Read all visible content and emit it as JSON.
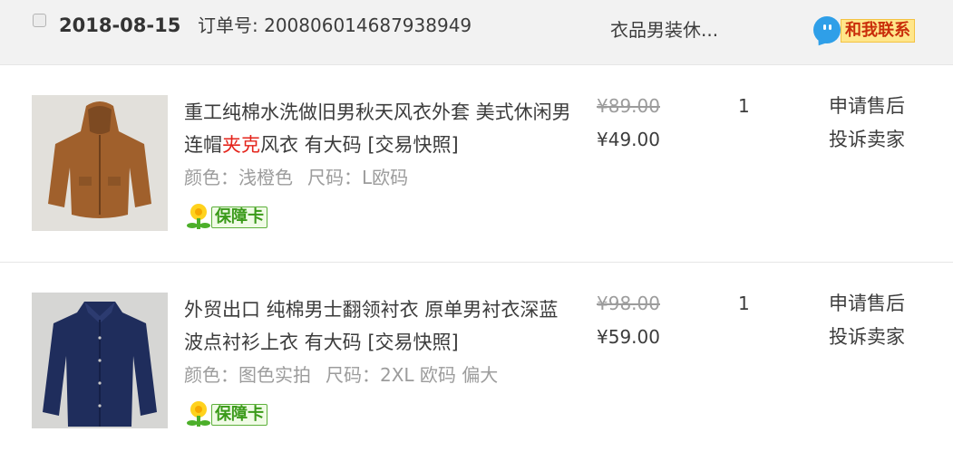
{
  "order": {
    "date": "2018-08-15",
    "order_number": "订单号: 200806014687938949",
    "shop_name": "衣品男装休...",
    "contact_label": "和我联系"
  },
  "items": [
    {
      "title_prefix": "重工纯棉水洗做旧男秋天风衣外套 美式休闲男连帽",
      "title_highlight": "夹克",
      "title_suffix": "风衣 有大码 [交易快照]",
      "color_label": "颜色：",
      "color_value": "浅橙色",
      "size_label": "尺码：",
      "size_value": "L欧码",
      "badge_label": "保障卡",
      "original_price": "¥89.00",
      "price": "¥49.00",
      "quantity": "1",
      "action_aftersale": "申请售后",
      "action_complain": "投诉卖家",
      "product_color": "#a0602c"
    },
    {
      "title_prefix": "外贸出口 纯棉男士翻领衬衣 原单男衬衣深蓝波点衬衫上衣 有大码 [交易快照]",
      "title_highlight": "",
      "title_suffix": "",
      "color_label": "颜色：",
      "color_value": "图色实拍",
      "size_label": "尺码：",
      "size_value": "2XL 欧码 偏大",
      "badge_label": "保障卡",
      "original_price": "¥98.00",
      "price": "¥59.00",
      "quantity": "1",
      "action_aftersale": "申请售后",
      "action_complain": "投诉卖家",
      "product_color": "#1f2d5c"
    }
  ],
  "colors": {
    "header_bg": "#f2f2f2",
    "highlight": "#e4241b",
    "badge_green": "#3a9a19",
    "contact_blue": "#2f9fe8"
  }
}
